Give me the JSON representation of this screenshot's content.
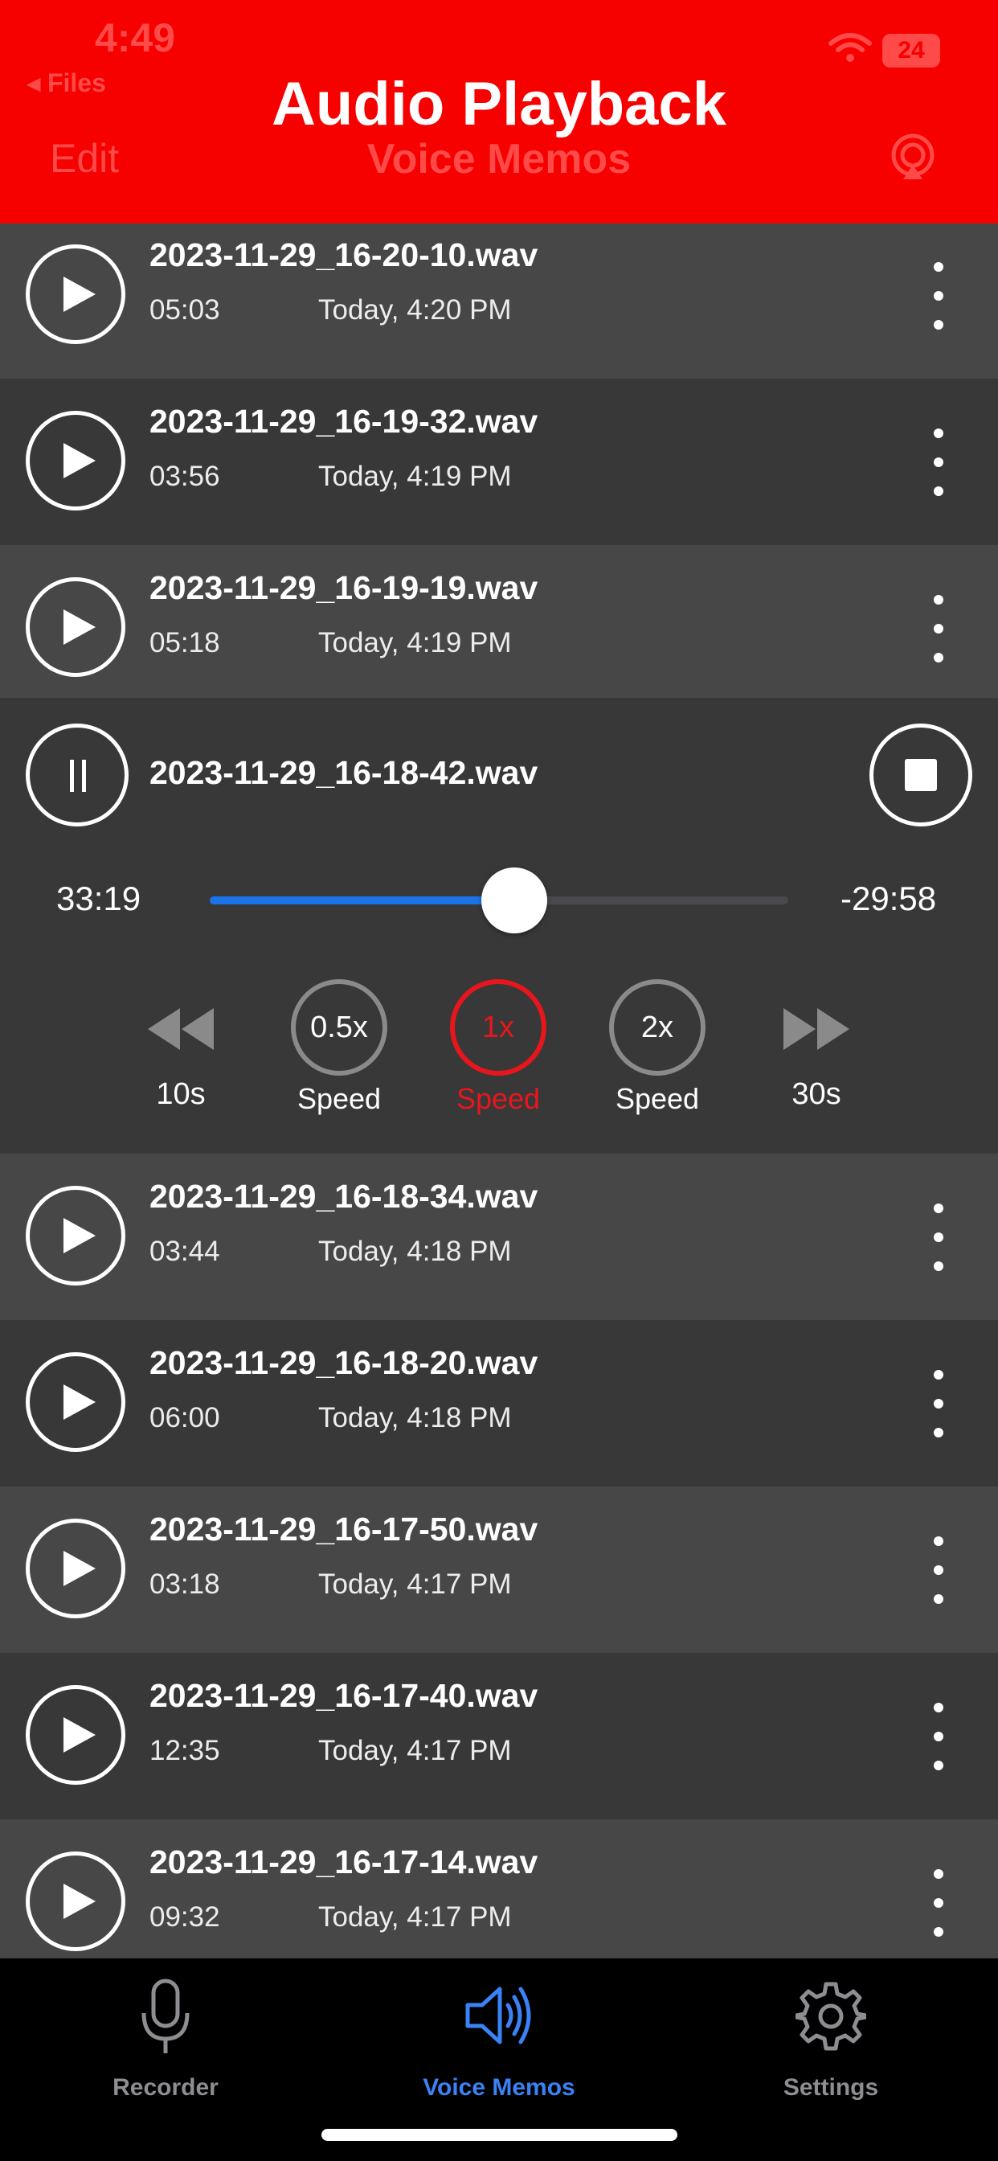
{
  "status_bar": {
    "time": "4:49",
    "back_label": "◂ Files",
    "battery": "24"
  },
  "underlying_nav": {
    "edit_label": "Edit",
    "title": "Voice Memos"
  },
  "header": {
    "title": "Audio Playback"
  },
  "recordings_before": [
    {
      "name": "2023-11-29_16-20-10.wav",
      "duration": "05:03",
      "date": "Today, 4:20 PM"
    },
    {
      "name": "2023-11-29_16-19-32.wav",
      "duration": "03:56",
      "date": "Today, 4:19 PM"
    },
    {
      "name": "2023-11-29_16-19-19.wav",
      "duration": "05:18",
      "date": "Today, 4:19 PM"
    }
  ],
  "player": {
    "name": "2023-11-29_16-18-42.wav",
    "elapsed": "33:19",
    "remaining": "-29:58",
    "progress_fraction": 0.526,
    "rewind_label": "10s",
    "forward_label": "30s",
    "speeds": [
      {
        "value": "0.5x",
        "label": "Speed",
        "active": false
      },
      {
        "value": "1x",
        "label": "Speed",
        "active": true
      },
      {
        "value": "2x",
        "label": "Speed",
        "active": false
      }
    ]
  },
  "recordings_after": [
    {
      "name": "2023-11-29_16-18-34.wav",
      "duration": "03:44",
      "date": "Today, 4:18 PM"
    },
    {
      "name": "2023-11-29_16-18-20.wav",
      "duration": "06:00",
      "date": "Today, 4:18 PM"
    },
    {
      "name": "2023-11-29_16-17-50.wav",
      "duration": "03:18",
      "date": "Today, 4:17 PM"
    },
    {
      "name": "2023-11-29_16-17-40.wav",
      "duration": "12:35",
      "date": "Today, 4:17 PM"
    },
    {
      "name": "2023-11-29_16-17-14.wav",
      "duration": "09:32",
      "date": "Today, 4:17 PM"
    }
  ],
  "tabs": [
    {
      "label": "Recorder",
      "icon": "microphone-icon",
      "active": false
    },
    {
      "label": "Voice Memos",
      "icon": "speaker-icon",
      "active": true
    },
    {
      "label": "Settings",
      "icon": "gear-icon",
      "active": false
    }
  ],
  "colors": {
    "header": "#f70000",
    "accent_blue": "#1a73e8",
    "active_red": "#e8161c",
    "tab_active": "#3a82f6"
  }
}
